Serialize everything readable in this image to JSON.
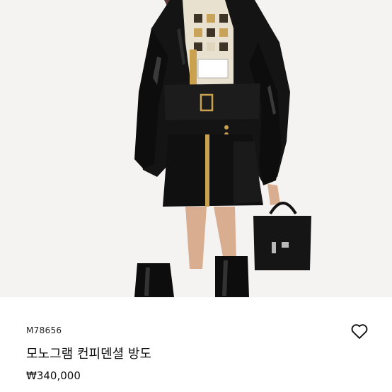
{
  "product": {
    "image_alt": "monogram-patent-jacket-model-photo",
    "sku": "M78656",
    "name": "모노그램 컨피덴셜 방도",
    "price": "₩340,000",
    "wishlist_icon": "heart-outline-icon"
  },
  "colors": {
    "background": "#ffffff",
    "photo_backdrop": "#f4f3f1",
    "text": "#111111",
    "leather": "#141414"
  }
}
